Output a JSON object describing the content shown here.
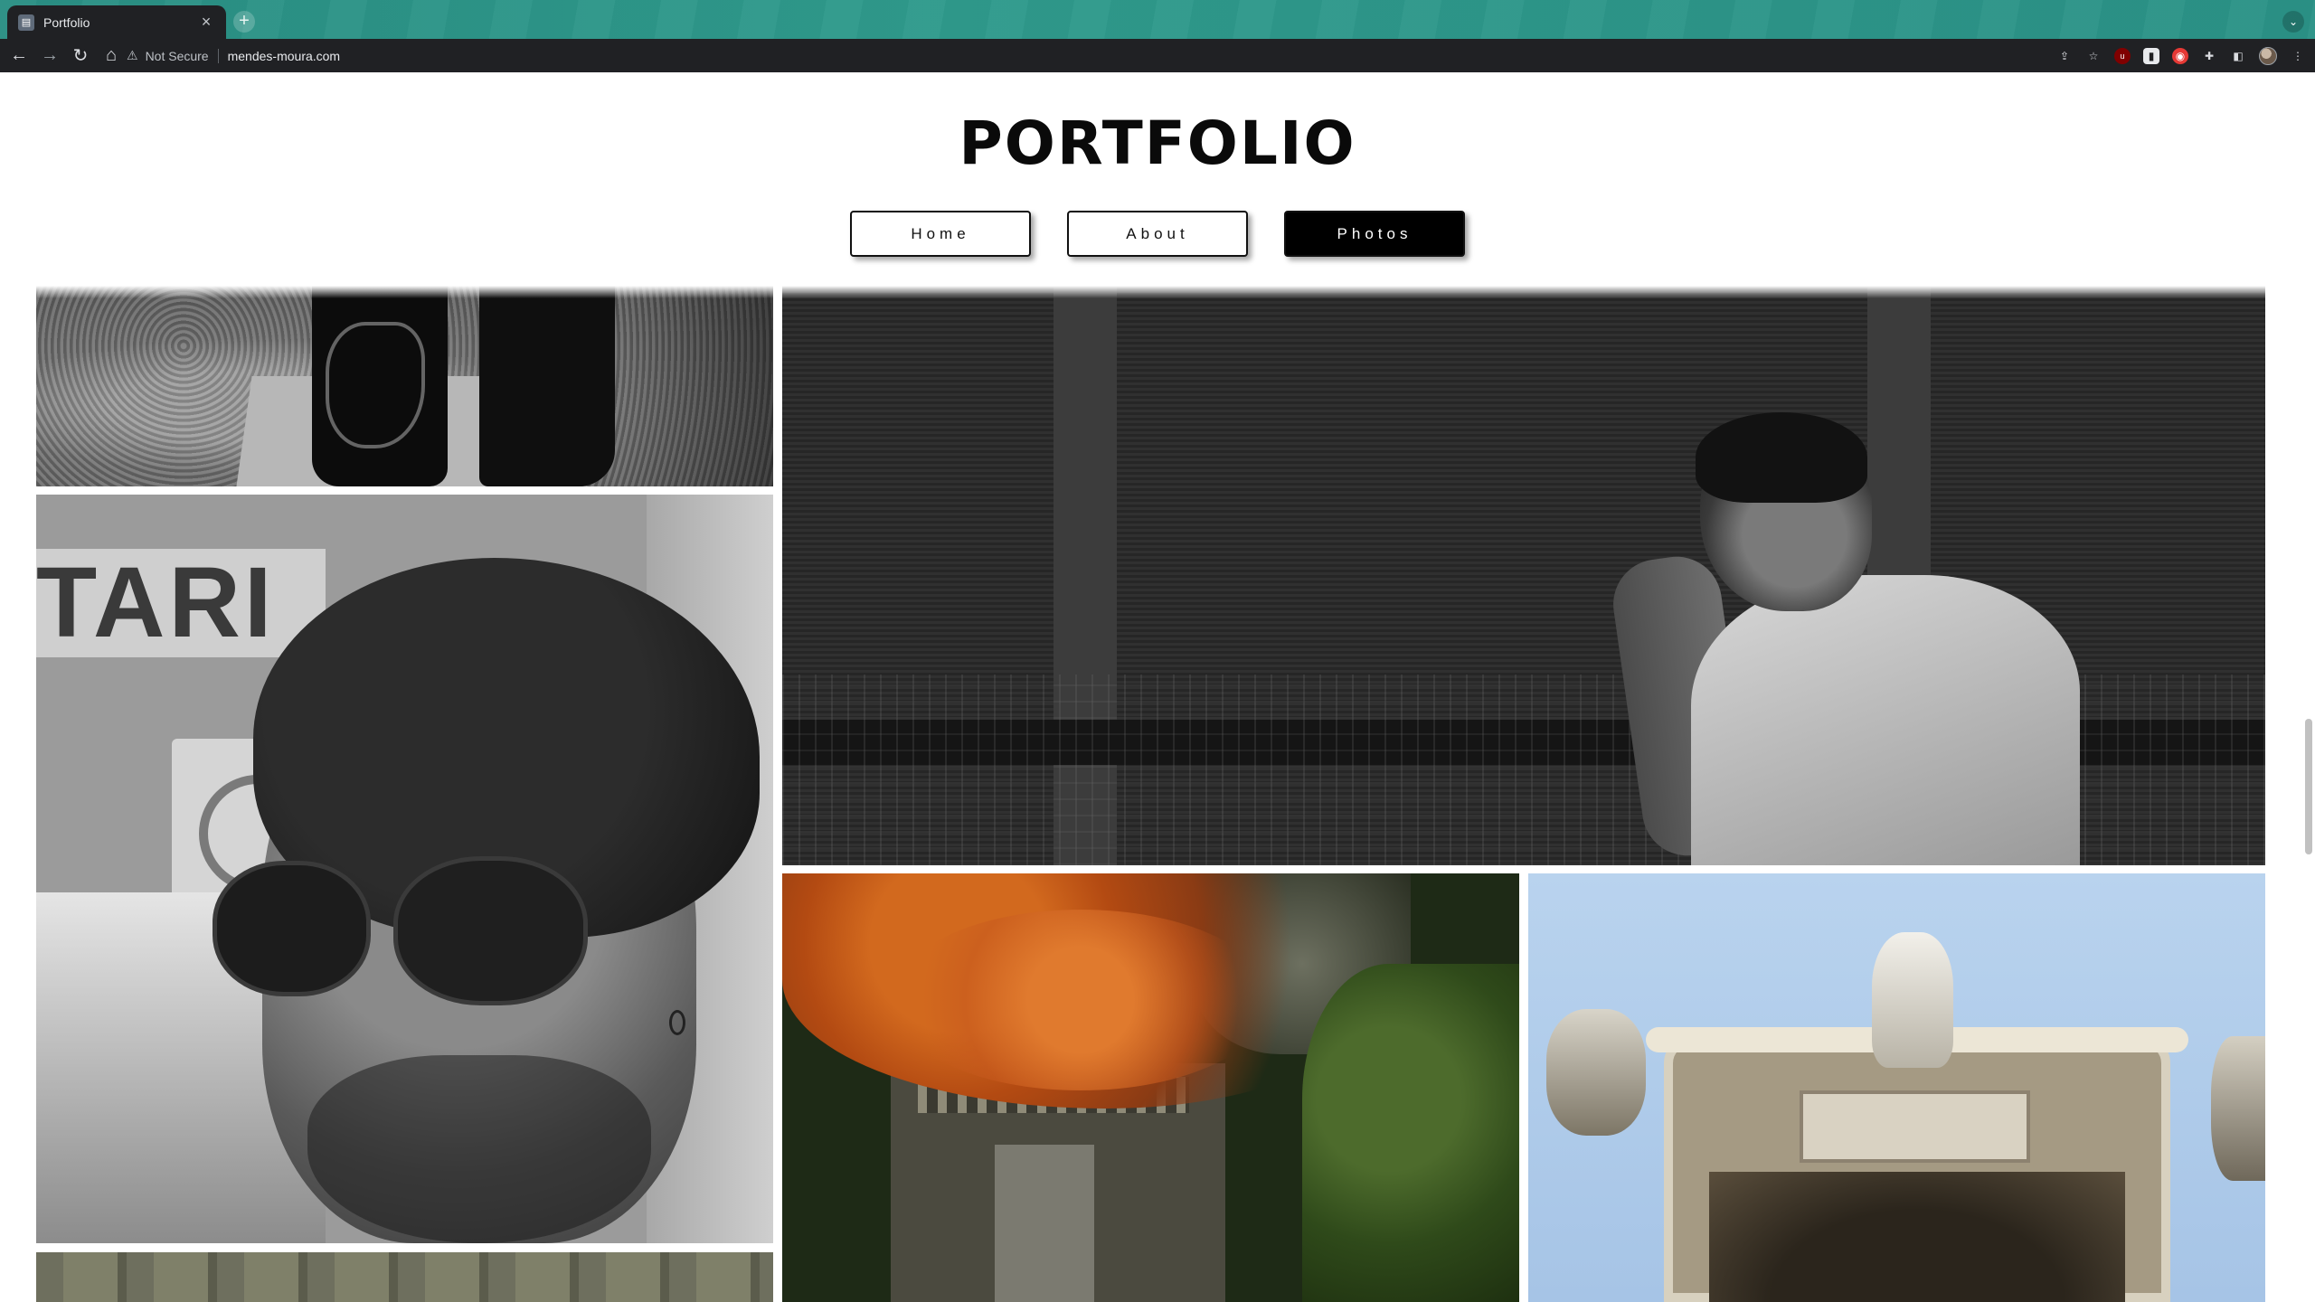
{
  "browser": {
    "tab_title": "Portfolio",
    "tab_close_glyph": "×",
    "new_tab_glyph": "+",
    "security_label": "Not Secure",
    "url": "mendes-moura.com"
  },
  "page": {
    "title": "PORTFOLIO",
    "nav": [
      {
        "label": "Home",
        "active": false
      },
      {
        "label": "About",
        "active": false
      },
      {
        "label": "Photos",
        "active": true
      }
    ]
  },
  "gallery": {
    "photos": [
      {
        "subject": "street legs"
      },
      {
        "subject": "man at cafe"
      },
      {
        "subject": "portrait with sunglasses"
      },
      {
        "subject": "autumn garden"
      },
      {
        "subject": "baroque gate"
      },
      {
        "subject": "building"
      }
    ]
  },
  "colors": {
    "tab_strip": "#2f9a8c",
    "toolbar": "#202124",
    "nav_active_bg": "#000000",
    "nav_border": "#111111"
  }
}
